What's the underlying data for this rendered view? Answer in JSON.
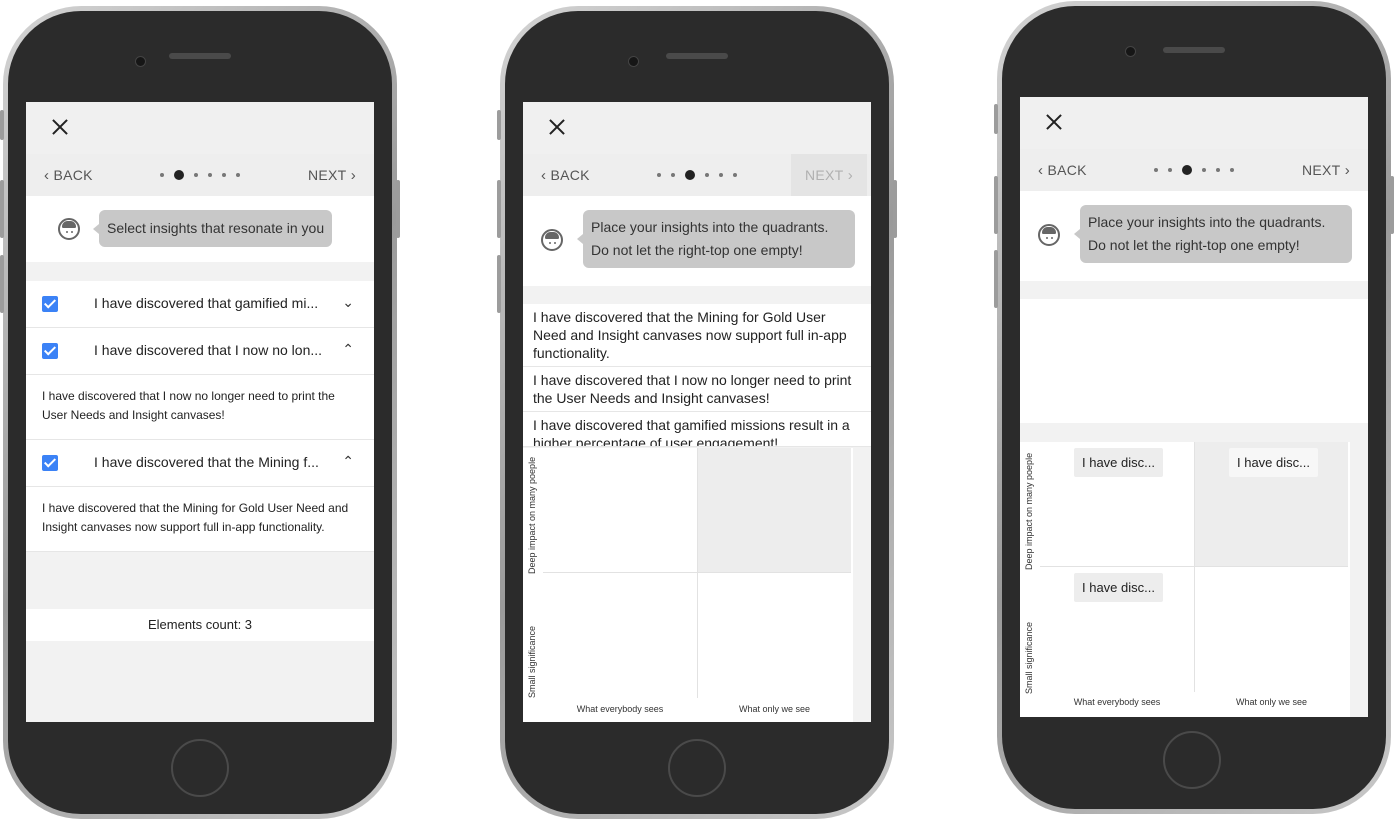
{
  "screen1": {
    "nav": {
      "back": "BACK",
      "next": "NEXT"
    },
    "bubble": "Select insights that resonate in you",
    "items": [
      {
        "title": "I have discovered that gamified mi...",
        "body": "",
        "expanded": false,
        "chevron": "chevron-down-icon"
      },
      {
        "title": "I have discovered that I now no lon...",
        "body": "I have discovered that I now no longer need to print the User Needs and Insight canvases!",
        "expanded": true,
        "chevron": "chevron-up-icon"
      },
      {
        "title": "I have discovered that the Mining f...",
        "body": "I have discovered that the Mining for Gold User Need and Insight canvases now support full in-app functionality.",
        "expanded": true,
        "chevron": "chevron-up-icon"
      }
    ],
    "count": "Elements count: 3"
  },
  "screen2": {
    "nav": {
      "back": "BACK",
      "next": "NEXT"
    },
    "bubble_line1": "Place your insights into the quadrants.",
    "bubble_line2": "Do not let the right-top one empty!",
    "cards": [
      "I have discovered that the Mining for Gold User Need and Insight canvases now support full in-app functionality.",
      "I have discovered that I now no longer need to print the User Needs and Insight canvases!",
      "I have discovered that gamified missions result in a higher percentage of user engagement!"
    ],
    "y_top": "Deep impact on many poeple",
    "y_bottom": "Small significance",
    "x_left": "What everybody sees",
    "x_right": "What only we see"
  },
  "screen3": {
    "nav": {
      "back": "BACK",
      "next": "NEXT"
    },
    "bubble_line1": "Place your insights into the quadrants.",
    "bubble_line2": "Do not let the right-top one empty!",
    "chips": [
      "I have disc...",
      "I have disc...",
      "I have disc..."
    ],
    "y_top": "Deep impact on many poeple",
    "y_bottom": "Small significance",
    "x_left": "What everybody sees",
    "x_right": "What only we see"
  },
  "icons": {
    "close": "close-icon",
    "back": "chevron-left-icon",
    "next": "chevron-right-icon",
    "avatar": "avatar-icon",
    "checkbox": "checkbox-checked-icon"
  },
  "colors": {
    "checkbox": "#3b82f6",
    "bubble": "#c8c8c8",
    "phone_body": "#2b2b2b"
  }
}
